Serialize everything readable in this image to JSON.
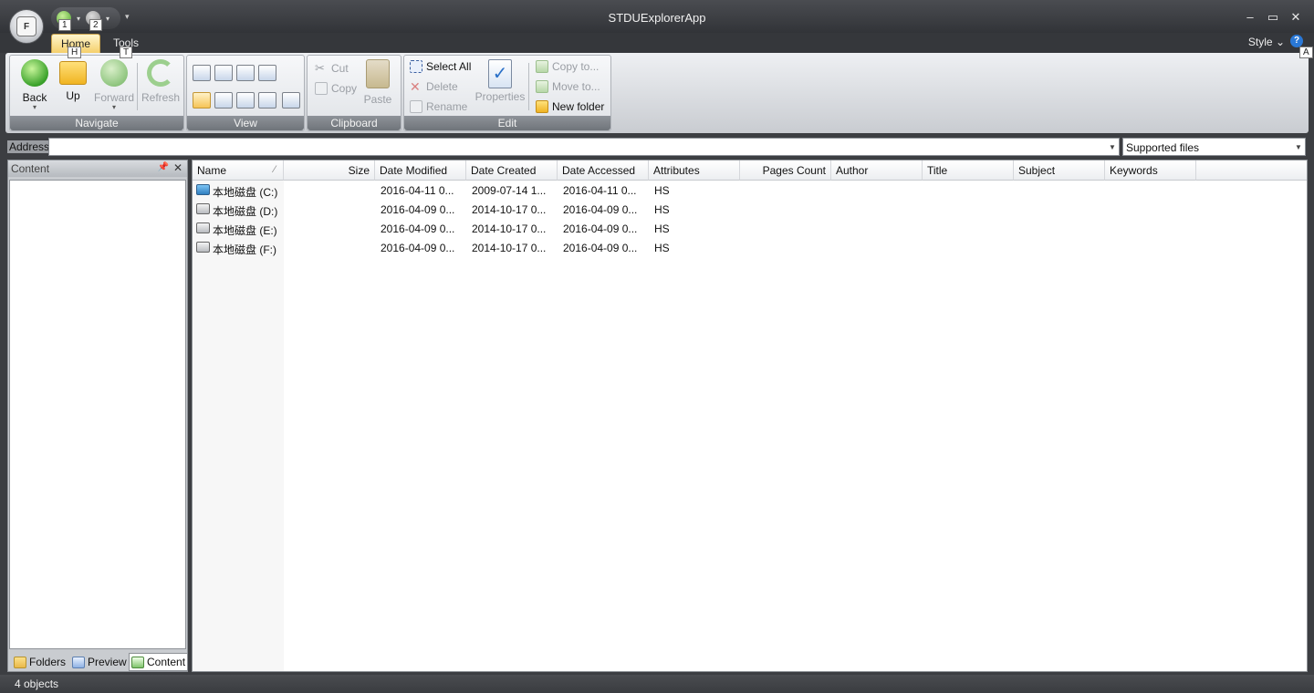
{
  "window": {
    "title": "STDUExplorerApp",
    "minimize": "–",
    "maximize": "▭",
    "close": "✕"
  },
  "app_menu": {
    "label": "F"
  },
  "keytips": {
    "qat1": "1",
    "qat2": "2",
    "home": "H",
    "tools": "T",
    "help": "A"
  },
  "tabs": [
    {
      "label": "Home",
      "active": true
    },
    {
      "label": "Tools",
      "active": false
    }
  ],
  "style_menu": {
    "label": "Style",
    "caret": "⌄"
  },
  "help": {
    "label": "?"
  },
  "ribbon": {
    "navigate": {
      "label": "Navigate",
      "back": "Back",
      "up": "Up",
      "forward": "Forward",
      "refresh": "Refresh"
    },
    "view": {
      "label": "View"
    },
    "clipboard": {
      "label": "Clipboard",
      "cut": "Cut",
      "copy": "Copy",
      "paste": "Paste"
    },
    "edit": {
      "label": "Edit",
      "select_all": "Select All",
      "delete": "Delete",
      "rename": "Rename",
      "properties": "Properties",
      "copy_to": "Copy to...",
      "move_to": "Move to...",
      "new_folder": "New folder"
    }
  },
  "address": {
    "label": "Address",
    "value": "",
    "filter": "Supported files"
  },
  "left_panel": {
    "title": "Content",
    "tabs": [
      {
        "label": "Folders"
      },
      {
        "label": "Preview"
      },
      {
        "label": "Content",
        "active": true
      }
    ]
  },
  "file_list": {
    "columns": [
      "Name",
      "Size",
      "Date Modified",
      "Date Created",
      "Date Accessed",
      "Attributes",
      "Pages Count",
      "Author",
      "Title",
      "Subject",
      "Keywords"
    ],
    "rows": [
      {
        "icon": "system-drive-icon",
        "name": "本地磁盘 (C:)",
        "size": "",
        "modified": "2016-04-11 0...",
        "created": "2009-07-14 1...",
        "accessed": "2016-04-11 0...",
        "attributes": "HS"
      },
      {
        "icon": "drive-icon",
        "name": "本地磁盘 (D:)",
        "size": "",
        "modified": "2016-04-09 0...",
        "created": "2014-10-17 0...",
        "accessed": "2016-04-09 0...",
        "attributes": "HS"
      },
      {
        "icon": "drive-icon",
        "name": "本地磁盘 (E:)",
        "size": "",
        "modified": "2016-04-09 0...",
        "created": "2014-10-17 0...",
        "accessed": "2016-04-09 0...",
        "attributes": "HS"
      },
      {
        "icon": "drive-icon",
        "name": "本地磁盘 (F:)",
        "size": "",
        "modified": "2016-04-09 0...",
        "created": "2014-10-17 0...",
        "accessed": "2016-04-09 0...",
        "attributes": "HS"
      }
    ]
  },
  "status": {
    "text": "4 objects"
  },
  "colors": {
    "titlebar": "#3a3c40",
    "active_tab": "#f5cf6b",
    "ribbon": "#dfe2e6",
    "group_label": "#7a7f85"
  }
}
